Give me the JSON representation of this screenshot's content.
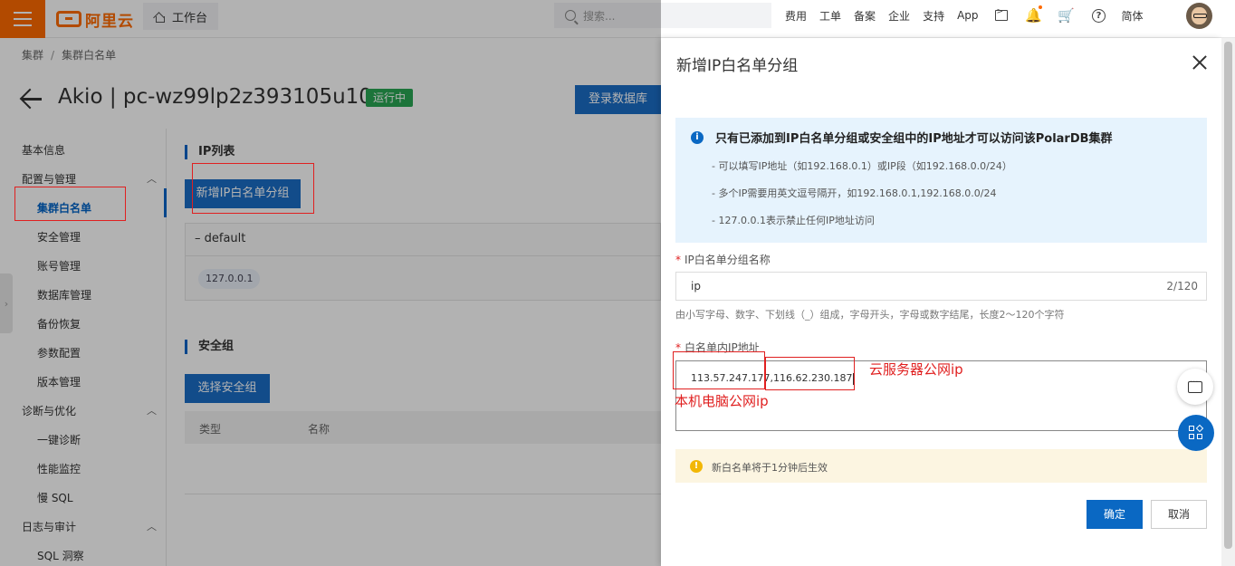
{
  "topbar": {
    "logo_text": "阿里云",
    "workbench": "工作台",
    "search_placeholder": "搜索...",
    "nav": [
      "费用",
      "工单",
      "备案",
      "企业",
      "支持",
      "App"
    ],
    "lang": "简体",
    "accent": "#ff6a00"
  },
  "breadcrumb": [
    "集群",
    "集群白名单"
  ],
  "cluster": {
    "title": "Akio | pc-wz99lp2z393105u10",
    "status": "运行中",
    "login_button": "登录数据库"
  },
  "sidenav": {
    "basic_info": "基本信息",
    "groups": [
      {
        "label": "配置与管理",
        "items": [
          "集群白名单",
          "安全管理",
          "账号管理",
          "数据库管理",
          "备份恢复",
          "参数配置",
          "版本管理"
        ]
      },
      {
        "label": "诊断与优化",
        "items": [
          "一键诊断",
          "性能监控",
          "慢 SQL"
        ]
      },
      {
        "label": "日志与审计",
        "items": [
          "SQL 洞察"
        ]
      }
    ],
    "active": "集群白名单"
  },
  "content": {
    "ip_list_title": "IP列表",
    "add_group_button": "新增IP白名单分组",
    "default_group": "–  default",
    "default_ip": "127.0.0.1",
    "security_group_title": "安全组",
    "select_sg_button": "选择安全组",
    "table_headers": [
      "类型",
      "名称"
    ]
  },
  "drawer": {
    "title": "新增IP白名单分组",
    "info": {
      "title": "只有已添加到IP白名单分组或安全组中的IP地址才可以访问该PolarDB集群",
      "lines": [
        "- 可以填写IP地址（如192.168.0.1）或IP段（如192.168.0.0/24）",
        "- 多个IP需要用英文逗号隔开，如192.168.0.1,192.168.0.0/24",
        "- 127.0.0.1表示禁止任何IP地址访问"
      ]
    },
    "name_label": "IP白名单分组名称",
    "name_value": "ip",
    "name_count": "2/120",
    "name_hint": "由小写字母、数字、下划线（_）组成，字母开头，字母或数字结尾，长度2～120个字符",
    "ip_label": "白名单内IP地址",
    "ip_value": "113.57.247.177,116.62.230.187",
    "annotation_server": "云服务器公网ip",
    "annotation_local": "本机电脑公网ip",
    "warn": "新白名单将于1分钟后生效",
    "ok": "确定",
    "cancel": "取消"
  }
}
